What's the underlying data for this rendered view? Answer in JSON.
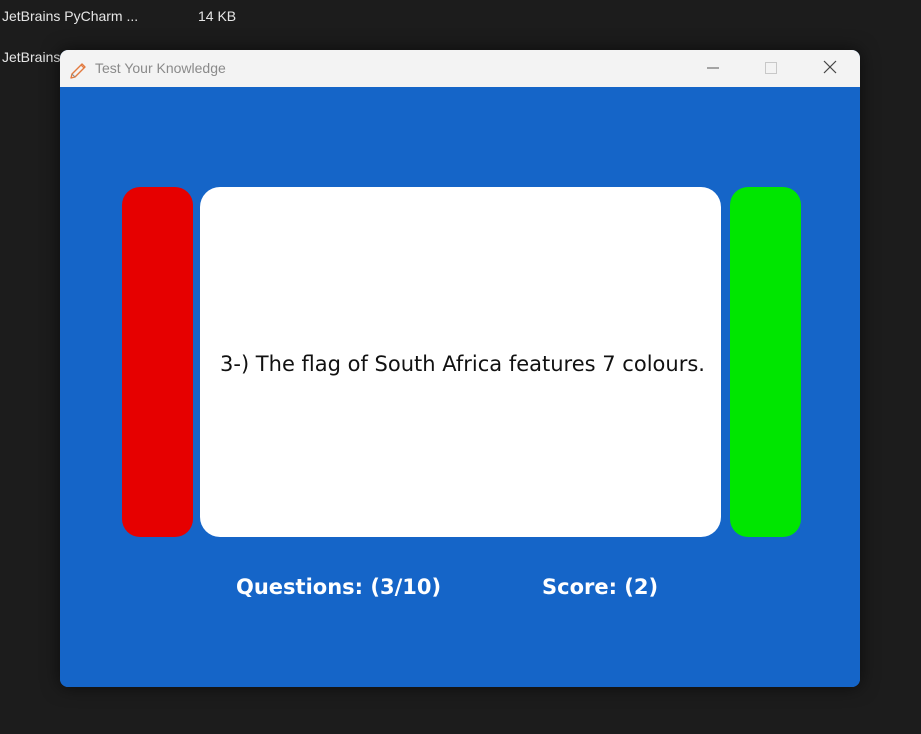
{
  "background": {
    "files": [
      {
        "name": "JetBrains PyCharm ...",
        "size": "14 KB"
      },
      {
        "name": "JetBrains",
        "size": ""
      }
    ]
  },
  "window": {
    "title": "Test Your Knowledge",
    "icon": "pencil-icon",
    "controls": {
      "minimize": "minimize-icon",
      "maximize": "maximize-icon",
      "close": "close-icon"
    }
  },
  "quiz": {
    "question_text": "3-) The flag of South Africa features 7 colours.",
    "questions_label": "Questions: (3/10)",
    "score_label": "Score: (2)",
    "colors": {
      "background": "#1565c8",
      "false_button": "#e60000",
      "true_button": "#00e600",
      "card": "#ffffff"
    }
  }
}
